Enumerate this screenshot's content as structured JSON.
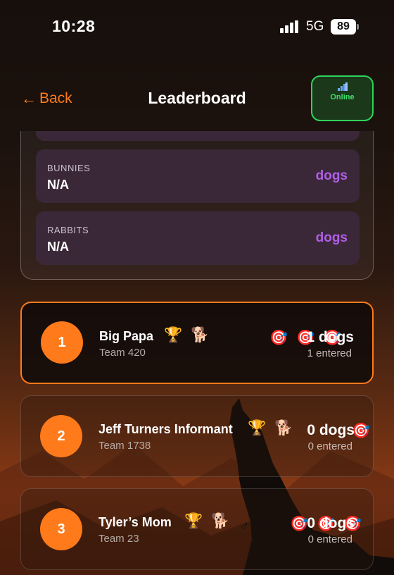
{
  "status": {
    "time": "10:28",
    "network": "5G",
    "battery": "89"
  },
  "nav": {
    "back_label": "Back",
    "title": "Leaderboard",
    "online_label": "Online"
  },
  "stats": [
    {
      "label": "BUNNIES",
      "value": "N/A",
      "unit": "dogs"
    },
    {
      "label": "RABBITS",
      "value": "N/A",
      "unit": "dogs"
    }
  ],
  "leaderboard": [
    {
      "rank": "1",
      "name": "Big Papa",
      "team": "Team 420",
      "count": "1 dogs",
      "entered": "1 entered"
    },
    {
      "rank": "2",
      "name": "Jeff Turners Informant",
      "team": "Team 1738",
      "count": "0 dogs",
      "entered": "0 entered"
    },
    {
      "rank": "3",
      "name": "Tyler’s Mom",
      "team": "Team 23",
      "count": "0 dogs",
      "entered": "0 entered"
    }
  ],
  "icons": {
    "back": "arrow-left-icon",
    "online": "signal-bars-icon",
    "trophy": "trophy-icon",
    "dog": "dog-icon",
    "male": "male-symbol-icon",
    "female": "female-symbol-icon",
    "target": "target-icon"
  },
  "colors": {
    "accent": "#ff7a1a",
    "online_border": "#2fd35a",
    "stat_unit": "#b15ee8",
    "stat_card": "#3a2838"
  }
}
